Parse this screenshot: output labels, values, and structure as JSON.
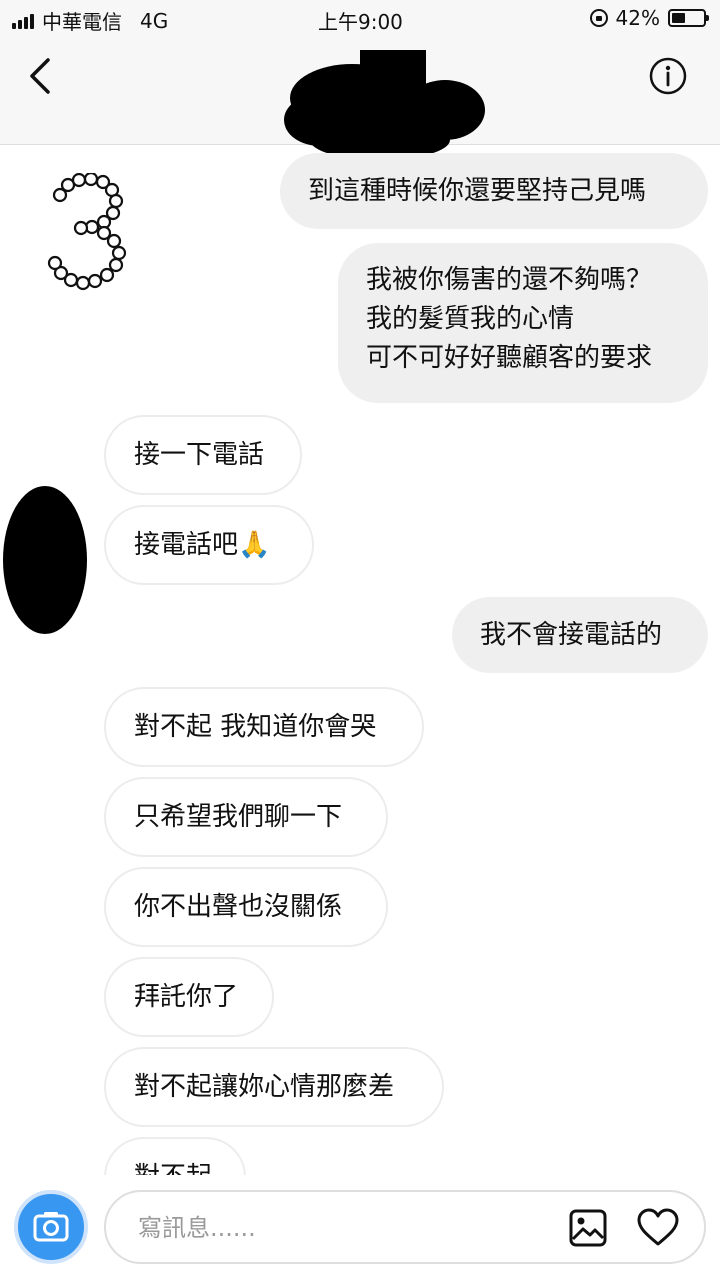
{
  "status_bar": {
    "carrier": "中華電信",
    "network": "4G",
    "time": "上午9:00",
    "battery_text": "42%",
    "battery_level": 0.42
  },
  "header": {
    "title_redacted": true,
    "back_icon": "chevron-left-icon",
    "info_icon": "info-icon"
  },
  "sticker": {
    "icon": "pearl-number-3-sticker"
  },
  "messages": [
    {
      "id": "m1",
      "direction": "sent",
      "text": "到這種時候你還要堅持己見嗎"
    },
    {
      "id": "m2",
      "direction": "sent",
      "text": "我被你傷害的還不夠嗎？\n我的髮質我的心情\n可不可好好聽顧客的要求"
    },
    {
      "id": "m3",
      "direction": "received",
      "text": "接一下電話"
    },
    {
      "id": "m4",
      "direction": "received",
      "text": "接電話吧🙏"
    },
    {
      "id": "m5",
      "direction": "sent",
      "text": "我不會接電話的"
    },
    {
      "id": "m6",
      "direction": "received",
      "text": "對不起 我知道你會哭"
    },
    {
      "id": "m7",
      "direction": "received",
      "text": "只希望我們聊一下"
    },
    {
      "id": "m8",
      "direction": "received",
      "text": "你不出聲也沒關係"
    },
    {
      "id": "m9",
      "direction": "received",
      "text": "拜託你了"
    },
    {
      "id": "m10",
      "direction": "received",
      "text": "對不起讓妳心情那麼差"
    },
    {
      "id": "m11",
      "direction": "received",
      "text": "對不起"
    }
  ],
  "composer": {
    "placeholder": "寫訊息......",
    "camera_icon": "camera-icon",
    "gallery_icon": "image-gallery-icon",
    "heart_icon": "heart-icon"
  },
  "colors": {
    "camera_blue": "#3897f0",
    "sent_bubble": "#efefef",
    "received_border": "#ececec",
    "header_bg": "#f7f7f7"
  }
}
